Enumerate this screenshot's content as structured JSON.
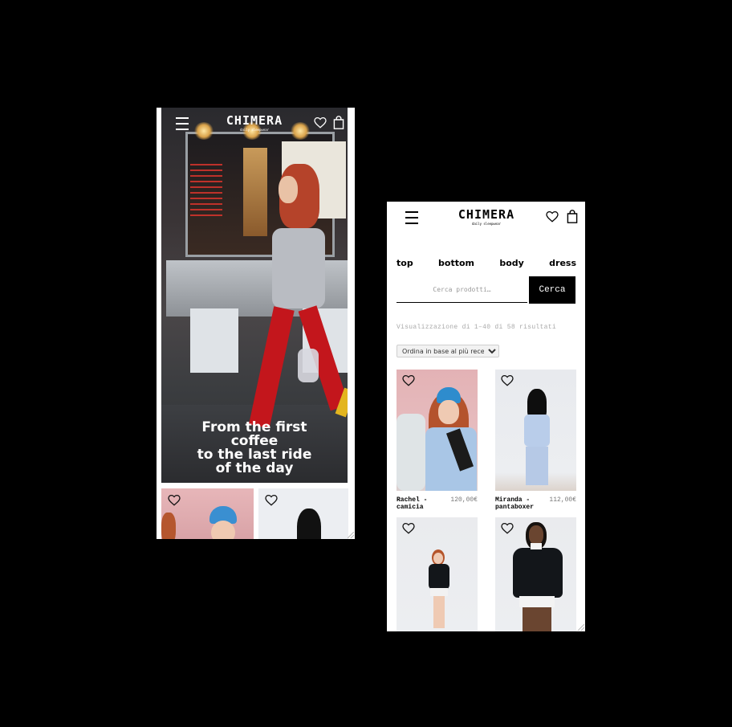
{
  "left_phone": {
    "header": {
      "logo_text": "CHIMERA",
      "logo_tagline": "daily sleepwear"
    },
    "hero": {
      "caption_lines": [
        "From the first",
        "coffee",
        "to the last ride",
        "of the day"
      ]
    }
  },
  "right_phone": {
    "header": {
      "logo_text": "CHIMERA",
      "logo_tagline": "daily sleepwear"
    },
    "categories": [
      "top",
      "bottom",
      "body",
      "dress"
    ],
    "search": {
      "placeholder": "Cerca prodotti…",
      "button_label": "Cerca"
    },
    "result_count": "Visualizzazione di 1–40 di 58 risultati",
    "sort": {
      "selected": "Ordina in base al più recente"
    },
    "products": [
      {
        "name": "Rachel - camicia",
        "price": "120,00€"
      },
      {
        "name": "Miranda - pantaboxer",
        "price": "112,00€"
      },
      {
        "name": "",
        "price": ""
      },
      {
        "name": "",
        "price": ""
      }
    ]
  },
  "icons": {
    "menu": "hamburger-menu-icon",
    "wishlist": "heart-icon",
    "cart": "shopping-bag-icon"
  },
  "colors": {
    "background": "#000000",
    "accent": "#000000",
    "price_text": "#777777",
    "hero_caption": "#ffffff"
  }
}
